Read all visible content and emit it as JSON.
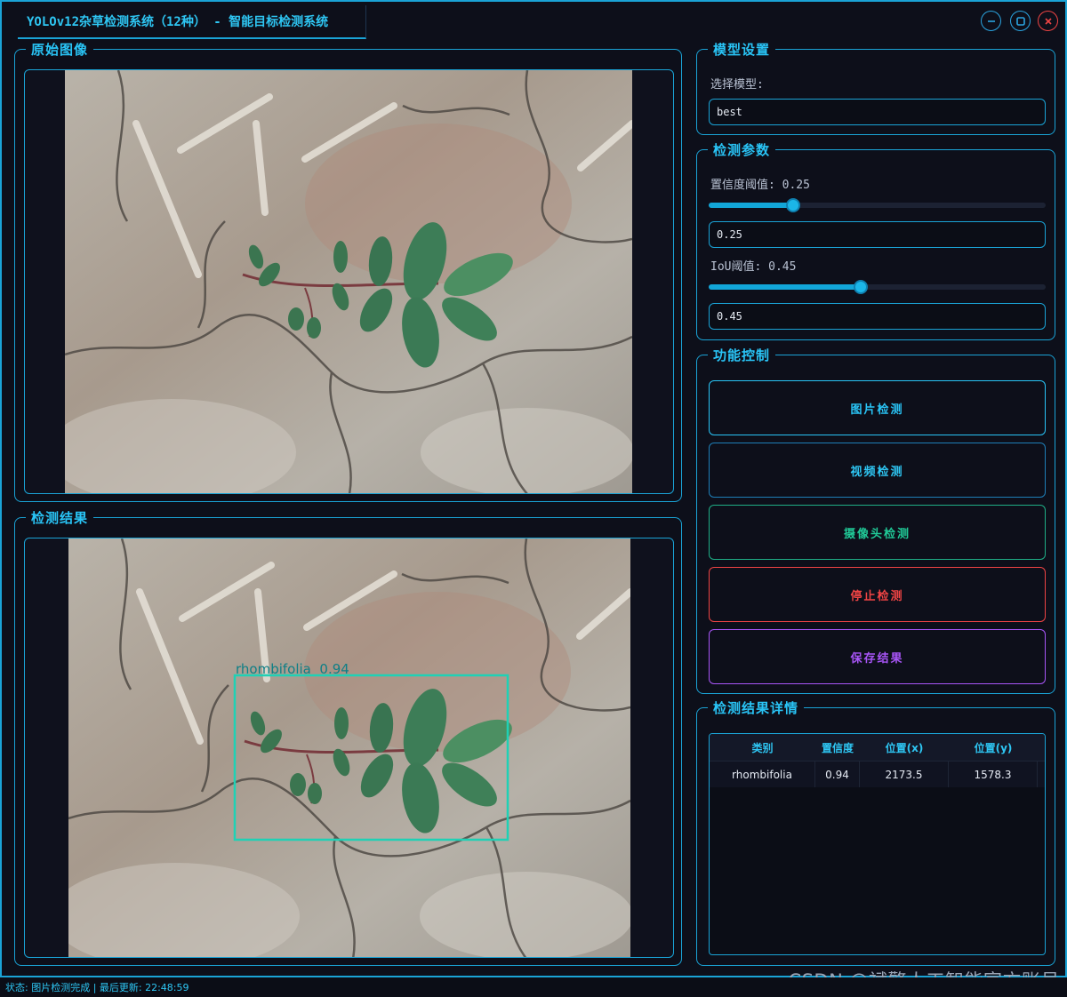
{
  "window": {
    "title": "YOLOv12杂草检测系统（12种） - 智能目标检测系统"
  },
  "panels": {
    "original_title": "原始图像",
    "result_title": "检测结果",
    "model_settings_title": "模型设置",
    "params_title": "检测参数",
    "controls_title": "功能控制",
    "details_title": "检测结果详情"
  },
  "model": {
    "select_label": "选择模型:",
    "selected": "best"
  },
  "params": {
    "conf_label": "置信度阈值: 0.25",
    "conf_value": "0.25",
    "conf_fraction": 0.25,
    "iou_label": "IoU阈值: 0.45",
    "iou_value": "0.45",
    "iou_fraction": 0.45
  },
  "controls": {
    "image_detect": "图片检测",
    "video_detect": "视频检测",
    "camera_detect": "摄像头检测",
    "stop_detect": "停止检测",
    "save_result": "保存结果"
  },
  "detection": {
    "label": "rhombifolia  0.94"
  },
  "table": {
    "headers": [
      "类别",
      "置信度",
      "位置(x)",
      "位置(y)"
    ],
    "rows": [
      [
        "rhombifolia",
        "0.94",
        "2173.5",
        "1578.3"
      ]
    ]
  },
  "status": {
    "text": "状态: 图片检测完成 | 最后更新: 22:48:59"
  },
  "watermark": "CSDN @斌擎人工智能官方账号",
  "colors": {
    "accent": "#1aa3d6",
    "image_btn": "#29c4f6",
    "video_btn": "#2ec6f3",
    "camera_btn": "#20c997",
    "stop_btn": "#ef4444",
    "save_btn": "#a855f7",
    "bbox": "#1fd1b5"
  },
  "icons": {
    "minimize": "minimize-icon",
    "maximize": "maximize-icon",
    "close": "close-icon"
  }
}
